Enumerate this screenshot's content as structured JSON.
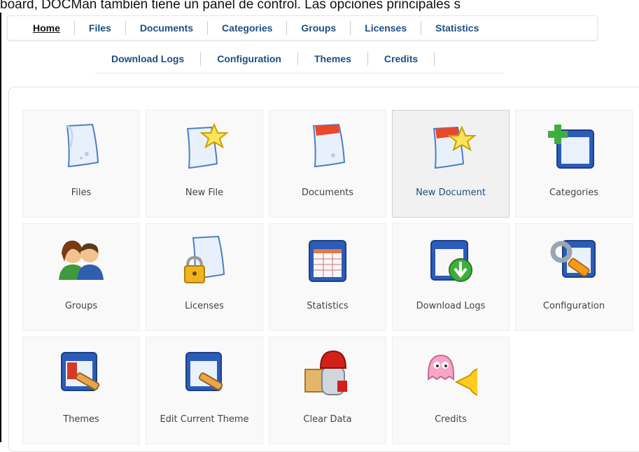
{
  "caption": "board, DOCMan también tiene un panel de control. Las opciones principales s",
  "nav_primary": [
    {
      "label": "Home",
      "active": true
    },
    {
      "label": "Files"
    },
    {
      "label": "Documents"
    },
    {
      "label": "Categories"
    },
    {
      "label": "Groups"
    },
    {
      "label": "Licenses"
    },
    {
      "label": "Statistics"
    }
  ],
  "nav_secondary": [
    {
      "label": "Download Logs"
    },
    {
      "label": "Configuration"
    },
    {
      "label": "Themes"
    },
    {
      "label": "Credits"
    }
  ],
  "tiles": [
    {
      "label": "Files",
      "icon": "file-icon"
    },
    {
      "label": "New File",
      "icon": "new-file-icon"
    },
    {
      "label": "Documents",
      "icon": "documents-icon"
    },
    {
      "label": "New Document",
      "icon": "new-document-icon",
      "hover": true
    },
    {
      "label": "Categories",
      "icon": "categories-icon"
    },
    {
      "label": "Groups",
      "icon": "groups-icon"
    },
    {
      "label": "Licenses",
      "icon": "licenses-icon"
    },
    {
      "label": "Statistics",
      "icon": "statistics-icon"
    },
    {
      "label": "Download Logs",
      "icon": "download-logs-icon"
    },
    {
      "label": "Configuration",
      "icon": "configuration-icon"
    },
    {
      "label": "Themes",
      "icon": "themes-icon"
    },
    {
      "label": "Edit Current Theme",
      "icon": "edit-theme-icon"
    },
    {
      "label": "Clear Data",
      "icon": "clear-data-icon"
    },
    {
      "label": "Credits",
      "icon": "credits-icon"
    }
  ],
  "colors": {
    "nav_link": "#1b4f82",
    "tile_bg": "#f9f9f9",
    "tile_border": "#eeeeee"
  }
}
